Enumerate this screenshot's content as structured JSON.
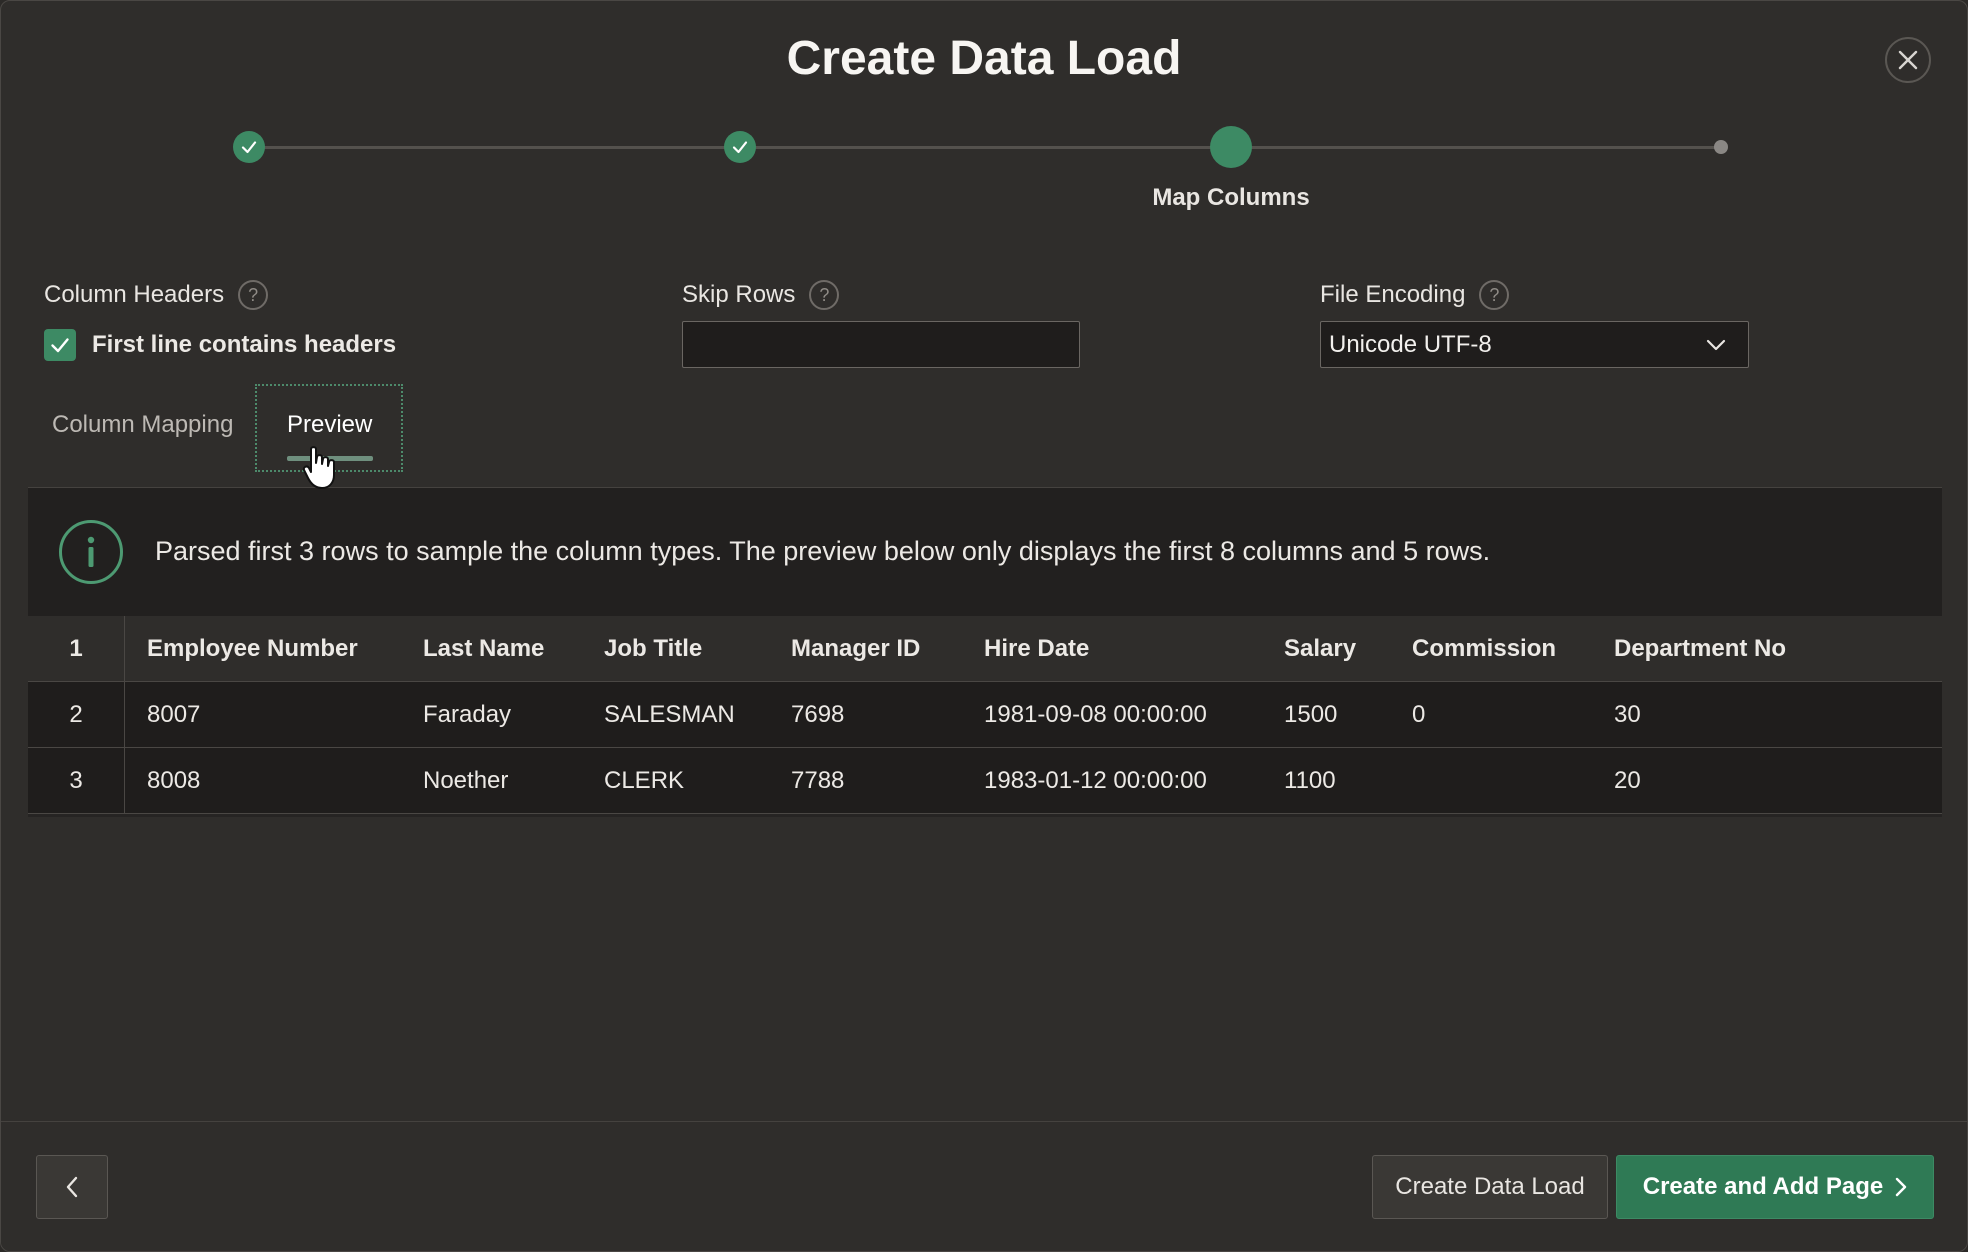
{
  "dialog": {
    "title": "Create Data Load"
  },
  "wizard": {
    "current_step_label": "Map Columns"
  },
  "fields": {
    "column_headers_label": "Column Headers",
    "first_line_headers_label": "First line contains headers",
    "first_line_headers_checked": true,
    "skip_rows_label": "Skip Rows",
    "skip_rows_value": "",
    "file_encoding_label": "File Encoding",
    "file_encoding_value": "Unicode UTF-8",
    "help_glyph": "?"
  },
  "tabs": {
    "mapping": "Column Mapping",
    "preview": "Preview",
    "active": "preview"
  },
  "info": {
    "message": "Parsed first 3 rows to sample the column types. The preview below only displays the first 8 columns and 5 rows."
  },
  "table": {
    "header_row_num": "1",
    "headers": [
      "Employee Number",
      "Last Name",
      "Job Title",
      "Manager ID",
      "Hire Date",
      "Salary",
      "Commission",
      "Department No"
    ],
    "rows": [
      {
        "num": "2",
        "cells": [
          "8007",
          "Faraday",
          "SALESMAN",
          "7698",
          "1981-09-08 00:00:00",
          "1500",
          "0",
          "30"
        ]
      },
      {
        "num": "3",
        "cells": [
          "8008",
          "Noether",
          "CLERK",
          "7788",
          "1983-01-12 00:00:00",
          "1100",
          "",
          "20"
        ]
      }
    ]
  },
  "footer": {
    "create_label": "Create Data Load",
    "create_add_page_label": "Create and Add Page"
  },
  "colors": {
    "accent": "#3d8a64",
    "primary_button": "#2f7a55",
    "background": "#2f2d2b"
  }
}
